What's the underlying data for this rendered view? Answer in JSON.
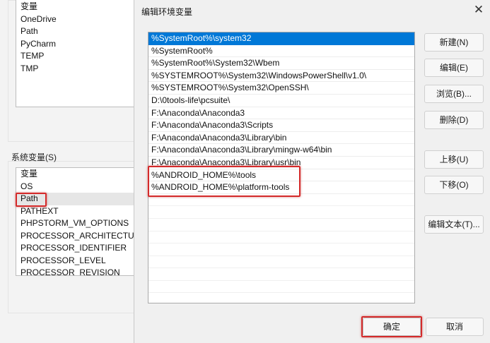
{
  "background_window": {
    "user_vars_list": [
      "变量",
      "OneDrive",
      "Path",
      "PyCharm",
      "TEMP",
      "TMP"
    ],
    "system_vars_label": "系统变量(S)",
    "system_vars_list": [
      "变量",
      "OS",
      "Path",
      "PATHEXT",
      "PHPSTORM_VM_OPTIONS",
      "PROCESSOR_ARCHITECTURE",
      "PROCESSOR_IDENTIFIER",
      "PROCESSOR_LEVEL",
      "PROCESSOR_REVISION"
    ],
    "highlighted_system_var": "Path"
  },
  "dialog": {
    "title": "编辑环境变量",
    "close_icon": "close-icon",
    "paths": [
      "%SystemRoot%\\system32",
      "%SystemRoot%",
      "%SystemRoot%\\System32\\Wbem",
      "%SYSTEMROOT%\\System32\\WindowsPowerShell\\v1.0\\",
      "%SYSTEMROOT%\\System32\\OpenSSH\\",
      "D:\\0tools-life\\pcsuite\\",
      "F:\\Anaconda\\Anaconda3",
      "F:\\Anaconda\\Anaconda3\\Scripts",
      "F:\\Anaconda\\Anaconda3\\Library\\bin",
      "F:\\Anaconda\\Anaconda3\\Library\\mingw-w64\\bin",
      "F:\\Anaconda\\Anaconda3\\Library\\usr\\bin",
      "%ANDROID_HOME%\\tools",
      "%ANDROID_HOME%\\platform-tools"
    ],
    "selected_index": 0,
    "buttons": {
      "new": "新建(N)",
      "edit": "编辑(E)",
      "browse": "浏览(B)...",
      "delete": "删除(D)",
      "move_up": "上移(U)",
      "move_down": "下移(O)",
      "edit_text": "编辑文本(T)...",
      "ok": "确定",
      "cancel": "取消"
    },
    "accent_color": "#0078d7",
    "highlight_color": "#d42a2a"
  }
}
